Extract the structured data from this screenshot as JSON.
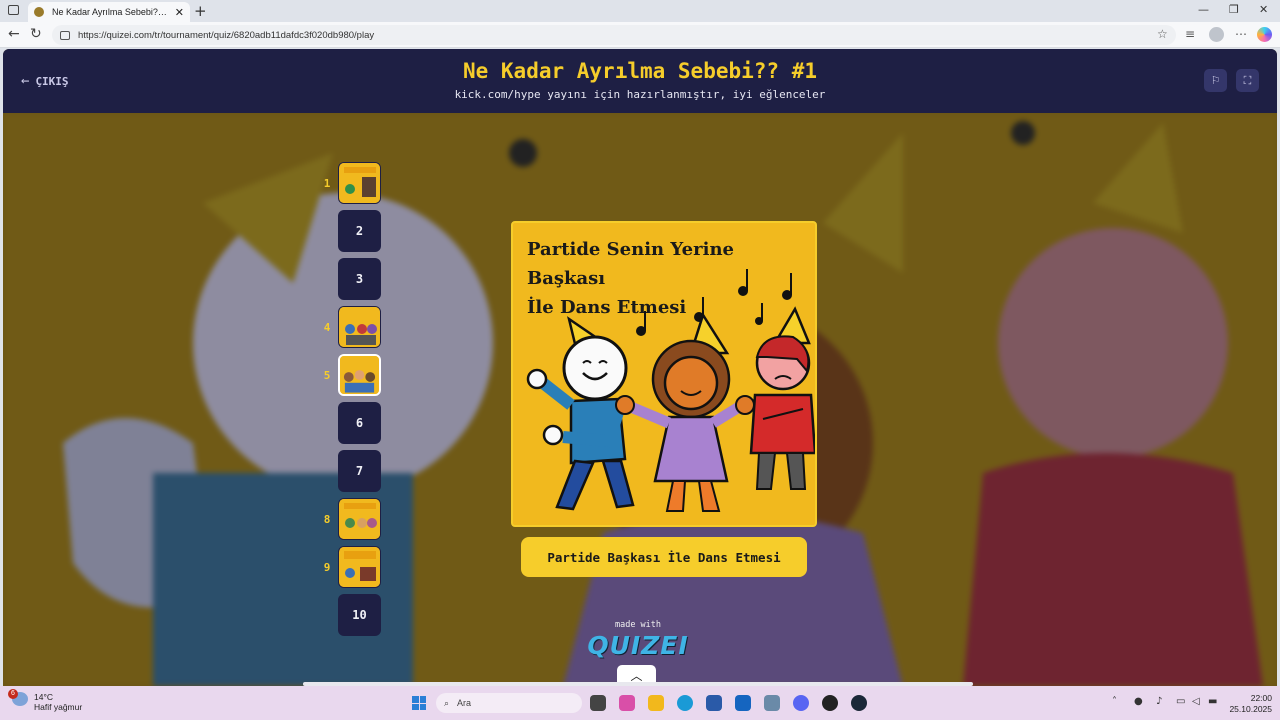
{
  "browser": {
    "tab_title": "Ne Kadar Ayrılma Sebebi?? #1 - Q",
    "url": "https://quizei.com/tr/tournament/quiz/6820adb11dafdc3f020db980/play"
  },
  "header": {
    "exit_label": "ÇIKIŞ",
    "title": "Ne Kadar Ayrılma Sebebi?? #1",
    "subtitle": "kick.com/hype yayını için hazırlanmıştır, iyi eğlenceler"
  },
  "sidebar": {
    "slots": [
      {
        "number": "1",
        "type": "image"
      },
      {
        "number": "2",
        "type": "empty"
      },
      {
        "number": "3",
        "type": "empty"
      },
      {
        "number": "4",
        "type": "image"
      },
      {
        "number": "5",
        "type": "image"
      },
      {
        "number": "6",
        "type": "empty"
      },
      {
        "number": "7",
        "type": "empty"
      },
      {
        "number": "8",
        "type": "image"
      },
      {
        "number": "9",
        "type": "image"
      },
      {
        "number": "10",
        "type": "empty"
      }
    ]
  },
  "card": {
    "title_line1": "Partide Senin Yerine Başkası",
    "title_line2": "İle Dans Etmesi",
    "answer_label": "Partide Başkası İle Dans Etmesi"
  },
  "footer": {
    "made_with": "made with",
    "logo_text": "QUIZEI"
  },
  "taskbar": {
    "weather_badge": "6",
    "temperature": "14°C",
    "weather_desc": "Hafif yağmur",
    "search_placeholder": "Ara",
    "time": "22:00",
    "date": "25.10.2025"
  },
  "colors": {
    "header_bg": "#1e1f44",
    "accent_yellow": "#f6cd2b",
    "card_bg": "#f1b91e"
  }
}
